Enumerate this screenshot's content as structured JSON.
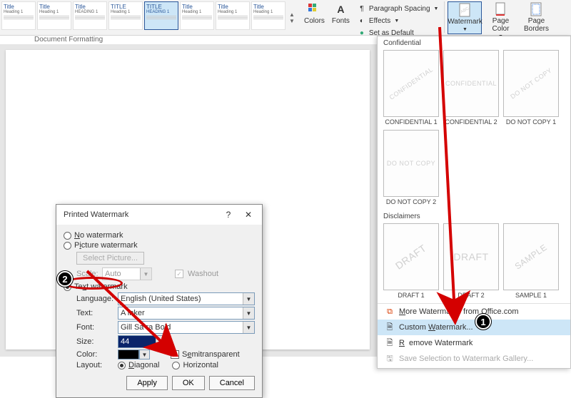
{
  "ribbon": {
    "styles": [
      {
        "title": "Title",
        "sub": "Heading 1"
      },
      {
        "title": "Title",
        "sub": "Heading 1"
      },
      {
        "title": "Title",
        "sub": "HEADING 1"
      },
      {
        "title": "TITLE",
        "sub": "Heading 1"
      },
      {
        "title": "TITLE",
        "sub": "HEADING 1",
        "selected": true
      },
      {
        "title": "Title",
        "sub": "Heading 1"
      },
      {
        "title": "Title",
        "sub": "Heading 1"
      },
      {
        "title": "Title",
        "sub": "Heading 1"
      }
    ],
    "group_label": "Document Formatting",
    "colors": "Colors",
    "fonts": "Fonts",
    "paragraph_spacing": "Paragraph Spacing",
    "effects": "Effects",
    "set_default": "Set as Default",
    "watermark": "Watermark",
    "page_color": "Page Color",
    "page_borders": "Page Borders"
  },
  "gallery": {
    "section_confidential": "Confidential",
    "section_disclaimers": "Disclaimers",
    "items_conf": [
      {
        "text": "CONFIDENTIAL",
        "cap": "CONFIDENTIAL 1"
      },
      {
        "text": "CONFIDENTIAL",
        "cap": "CONFIDENTIAL 2"
      },
      {
        "text": "DO NOT COPY",
        "cap": "DO NOT COPY 1"
      },
      {
        "text": "DO NOT COPY",
        "cap": "DO NOT COPY 2"
      }
    ],
    "items_disc": [
      {
        "text": "DRAFT",
        "cap": "DRAFT 1"
      },
      {
        "text": "DRAFT",
        "cap": "DRAFT 2"
      },
      {
        "text": "SAMPLE",
        "cap": "SAMPLE 1"
      }
    ],
    "more": "More Watermarks from Office.com",
    "custom": "Custom Watermark...",
    "remove": "Remove Watermark",
    "save": "Save Selection to Watermark Gallery..."
  },
  "dialog": {
    "title": "Printed Watermark",
    "no_wm": "No watermark",
    "pic_wm": "Picture watermark",
    "select_pic": "Select Picture...",
    "scale": "Scale:",
    "scale_val": "Auto",
    "washout": "Washout",
    "text_wm": "Text watermark",
    "language": "Language:",
    "language_val": "English (United States)",
    "text": "Text:",
    "text_val": "A     inker",
    "font": "Font:",
    "font_val": "Gill Sa        ra Bold",
    "size": "Size:",
    "size_val": "44",
    "color": "Color:",
    "semi": "Semitransparent",
    "layout": "Layout:",
    "diagonal": "Diagonal",
    "horizontal": "Horizontal",
    "apply": "Apply",
    "ok": "OK",
    "cancel": "Cancel"
  },
  "steps": {
    "one": "1",
    "two": "2"
  }
}
